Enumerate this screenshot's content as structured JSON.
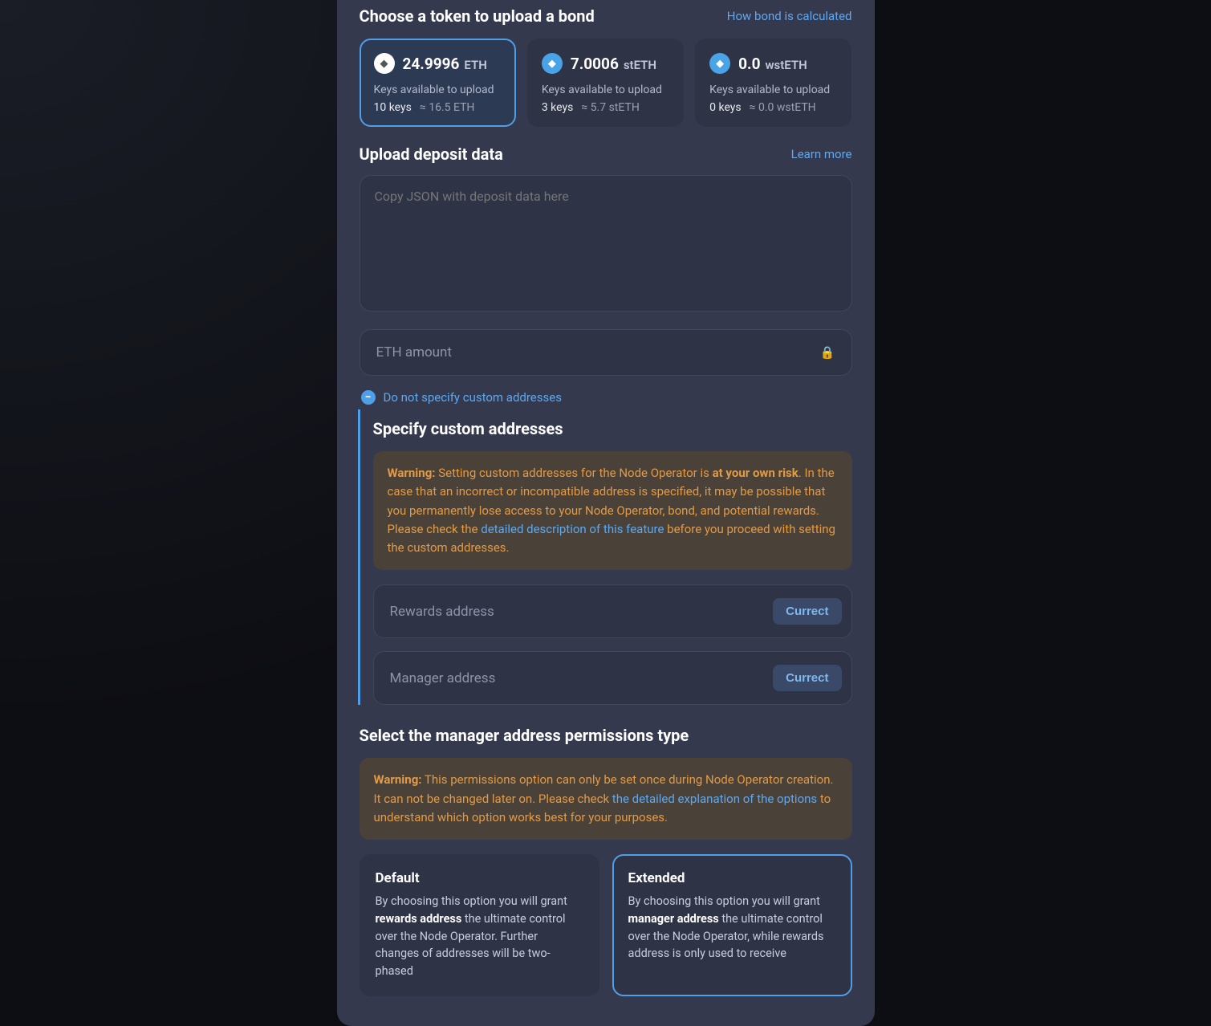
{
  "section1": {
    "title": "Choose a token to upload a bond",
    "link": "How bond is calculated"
  },
  "tokens": [
    {
      "amount": "24.9996",
      "symbol": "ETH",
      "sub": "Keys available to upload",
      "keys": "10 keys",
      "approx": "≈ 16.5 ETH",
      "selected": true,
      "icon": "eth"
    },
    {
      "amount": "7.0006",
      "symbol": "stETH",
      "sub": "Keys available to upload",
      "keys": "3 keys",
      "approx": "≈ 5.7 stETH",
      "selected": false,
      "icon": "steth"
    },
    {
      "amount": "0.0",
      "symbol": "wstETH",
      "sub": "Keys available to upload",
      "keys": "0 keys",
      "approx": "≈ 0.0 wstETH",
      "selected": false,
      "icon": "wsteth"
    }
  ],
  "section2": {
    "title": "Upload deposit data",
    "link": "Learn more",
    "textarea_placeholder": "Copy JSON with deposit data here",
    "amount_placeholder": "ETH amount"
  },
  "toggle": {
    "label": "Do not specify custom addresses"
  },
  "custom": {
    "title": "Specify custom addresses",
    "warn_prefix": "Warning:",
    "warn_text1": " Setting custom addresses for the Node Operator is ",
    "warn_bold": "at your own risk",
    "warn_text2": ". In the case that an incorrect or incompatible address is specified, it may be possible that you permanently lose access to your Node Operator, bond, and potential rewards. Please check the ",
    "warn_link": "detailed description of this feature",
    "warn_text3": " before you proceed with setting the custom addresses.",
    "rewards_placeholder": "Rewards address",
    "manager_placeholder": "Manager address",
    "curr_btn": "Currect"
  },
  "perm": {
    "title": "Select the manager address permissions type",
    "warn_prefix": "Warning:",
    "warn_text1": " This permissions option can only be set once during Node Operator creation. It can not be changed later on. Please check ",
    "warn_link": "the detailed explanation of the options",
    "warn_text2": " to understand which option works best for your purposes.",
    "options": [
      {
        "name": "Default",
        "desc1": "By choosing this option you will grant ",
        "bold": "rewards address",
        "desc2": " the ultimate control over the Node Operator. Further changes of addresses will be two-phased",
        "selected": false
      },
      {
        "name": "Extended",
        "desc1": "By choosing this option you will grant ",
        "bold": "manager address",
        "desc2": " the ultimate control over the Node Operator, while rewards address is only used to receive",
        "selected": true
      }
    ]
  }
}
